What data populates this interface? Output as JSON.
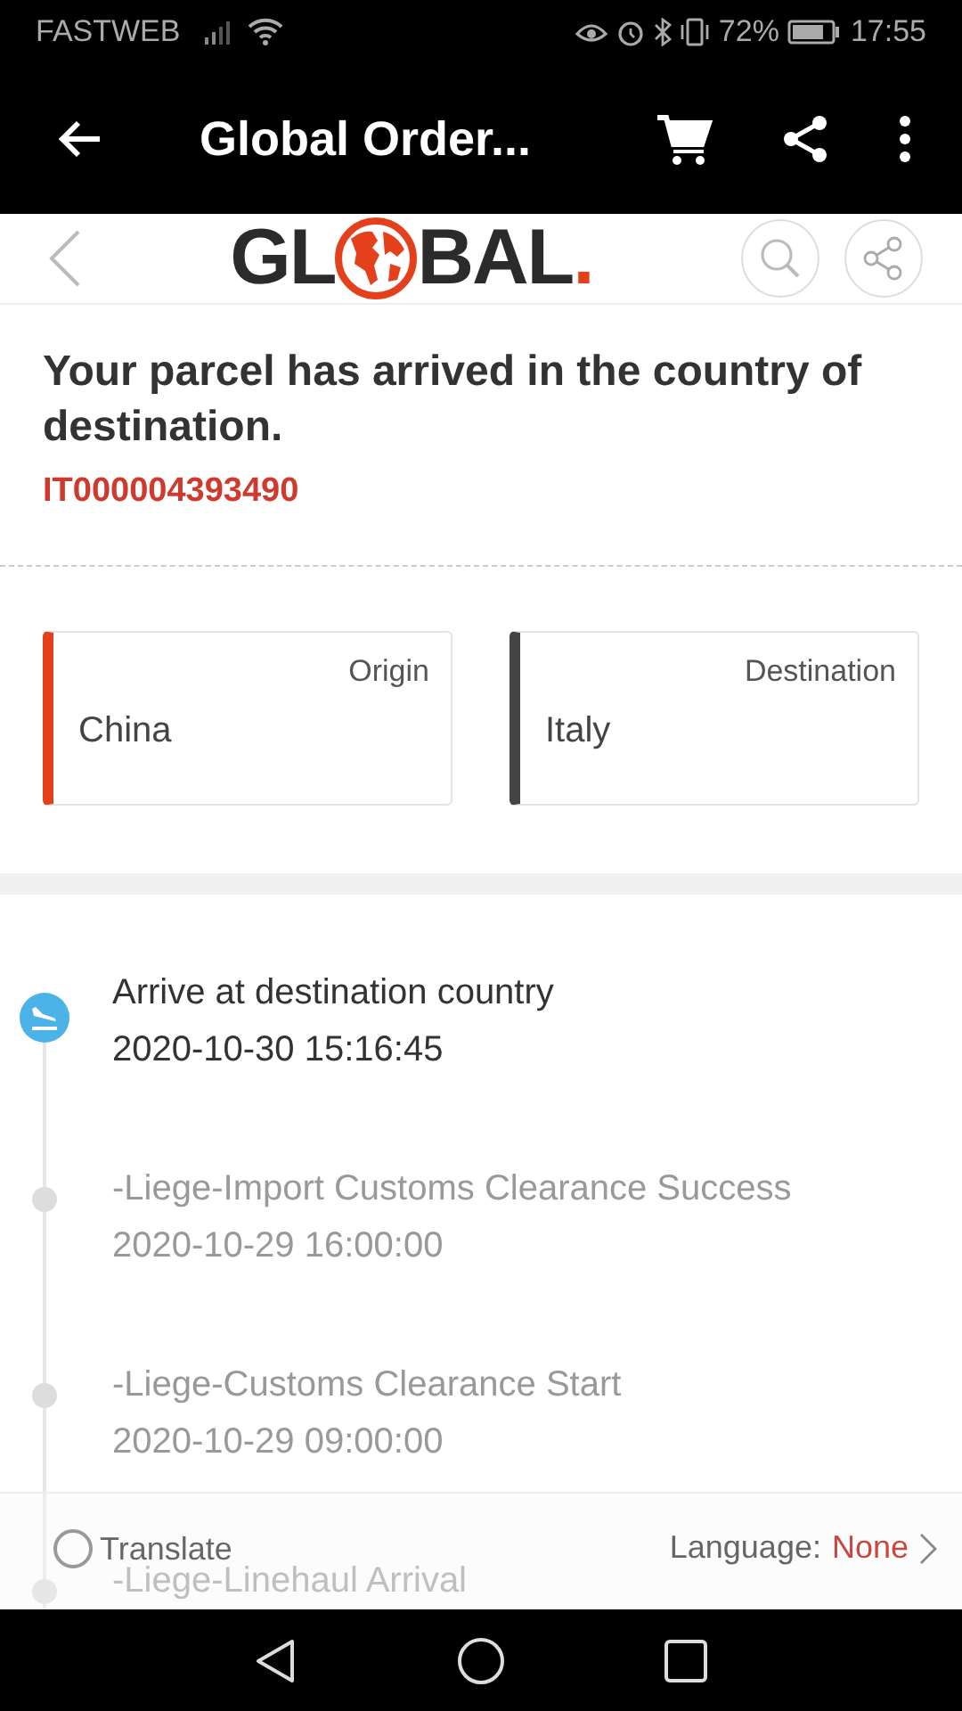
{
  "status_bar": {
    "carrier": "FASTWEB",
    "battery": "72%",
    "time": "17:55"
  },
  "app_bar": {
    "title": "Global Order..."
  },
  "logo": {
    "left": "GL",
    "right": "BAL",
    "dot": "."
  },
  "parcel": {
    "status": "Your parcel has arrived in the country of destination.",
    "tracking": "IT000004393490"
  },
  "route": [
    {
      "label": "Origin",
      "country": "China",
      "color": "#e5401c"
    },
    {
      "label": "Destination",
      "country": "Italy",
      "color": "#444444"
    }
  ],
  "events": [
    {
      "title": "Arrive at destination country",
      "time": "2020-10-30 15:16:45",
      "kind": "current"
    },
    {
      "title": "-Liege-Import Customs Clearance Success",
      "time": "2020-10-29 16:00:00",
      "kind": "past"
    },
    {
      "title": "-Liege-Customs Clearance Start",
      "time": "2020-10-29 09:00:00",
      "kind": "past"
    },
    {
      "title": "-Liege-Linehaul Arrival",
      "kind": "past"
    }
  ],
  "translate": {
    "label": "Translate",
    "checked": false,
    "language_label": "Language:",
    "language_value": "None"
  }
}
